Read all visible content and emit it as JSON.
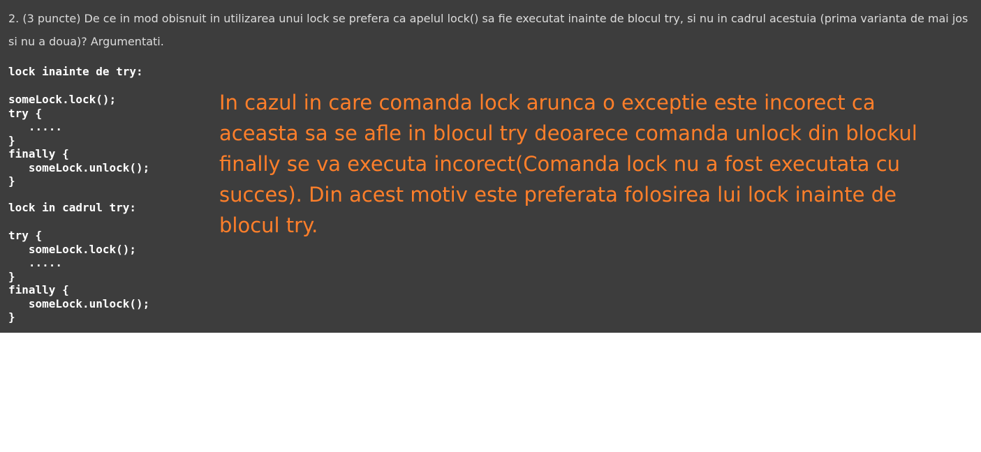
{
  "question": {
    "text": "2. (3 puncte) De ce in mod obisnuit in utilizarea unui lock se prefera ca apelul lock() sa fie executat inainte de blocul try, si nu in cadrul acestuia (prima varianta de mai jos si nu a doua)? Argumentati."
  },
  "variant1": {
    "heading": "lock inainte de try:",
    "code": "someLock.lock();\ntry {\n   .....\n}\nfinally {\n   someLock.unlock();\n}"
  },
  "variant2": {
    "heading": "lock in cadrul try:",
    "code": "try {\n   someLock.lock();\n   .....\n}\nfinally {\n   someLock.unlock();\n}"
  },
  "answer": {
    "text": "In cazul in care comanda lock arunca o exceptie este incorect ca aceasta sa se afle in blocul try deoarece comanda unlock din blockul finally se va executa incorect(Comanda lock nu a fost executata cu succes). Din acest motiv este preferata folosirea lui lock inainte de blocul try."
  },
  "colors": {
    "panel_background": "#3d3d3d",
    "question_text": "#dcdcdc",
    "code_text": "#ffffff",
    "answer_text": "#ff7f2a"
  }
}
